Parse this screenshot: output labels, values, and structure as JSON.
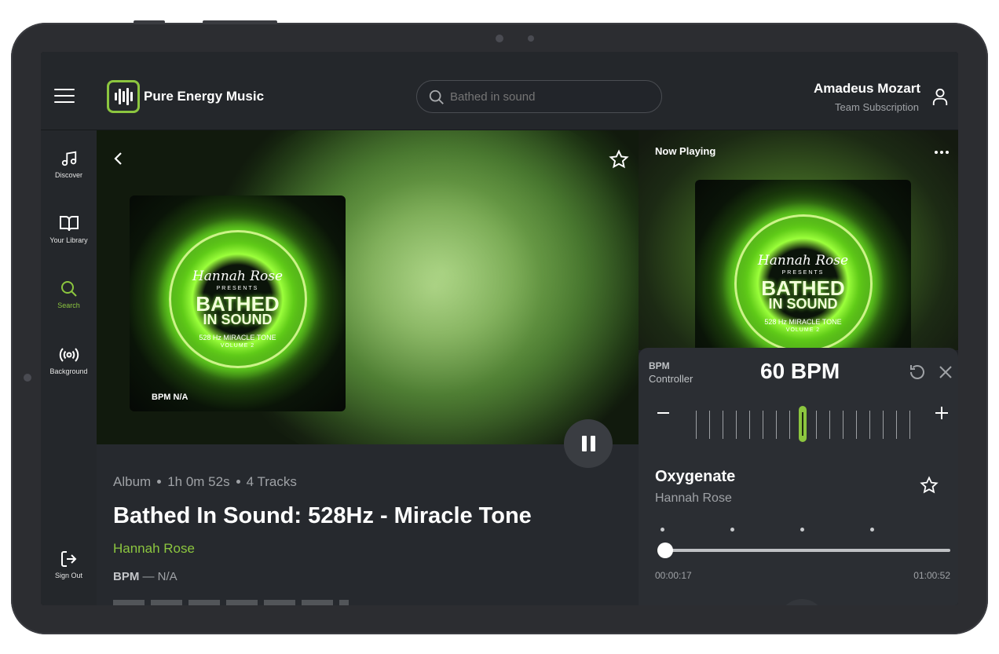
{
  "app": {
    "brand": "Pure Energy Music"
  },
  "search": {
    "placeholder": "Bathed in sound",
    "value": ""
  },
  "user": {
    "name": "Amadeus Mozart",
    "subscription": "Team Subscription"
  },
  "sidebar": {
    "items": [
      {
        "label": "Discover",
        "icon": "music-note-icon",
        "active": false
      },
      {
        "label": "Your Library",
        "icon": "book-icon",
        "active": true
      },
      {
        "label": "Search",
        "icon": "search-icon",
        "active": true
      },
      {
        "label": "Background",
        "icon": "broadcast-icon",
        "active": false
      }
    ],
    "signout": "Sign Out"
  },
  "cover": {
    "artist": "Hannah Rose",
    "presents": "PRESENTS",
    "title_line1": "BATHED",
    "title_line2": "IN SOUND",
    "subtitle": "528 Hz MIRACLE TONE",
    "volume": "VOLUME 2",
    "bpm": "BPM N/A"
  },
  "album": {
    "type": "Album",
    "duration": "1h 0m 52s",
    "tracks": "4 Tracks",
    "title": "Bathed In Sound: 528Hz - Miracle Tone",
    "artist": "Hannah Rose",
    "bpm_label": "BPM",
    "bpm_value": "— N/A"
  },
  "now_playing": {
    "label": "Now Playing",
    "bpm_controller": {
      "label": "BPM",
      "sublabel": "Controller",
      "value": "60 BPM"
    },
    "track": {
      "title": "Oxygenate",
      "artist": "Hannah Rose"
    },
    "progress": {
      "current": "00:00:17",
      "total": "01:00:52",
      "fraction": 0.005
    }
  },
  "colors": {
    "accent": "#8cc63f",
    "background": "#1e2024",
    "panel": "#2b2e33"
  }
}
